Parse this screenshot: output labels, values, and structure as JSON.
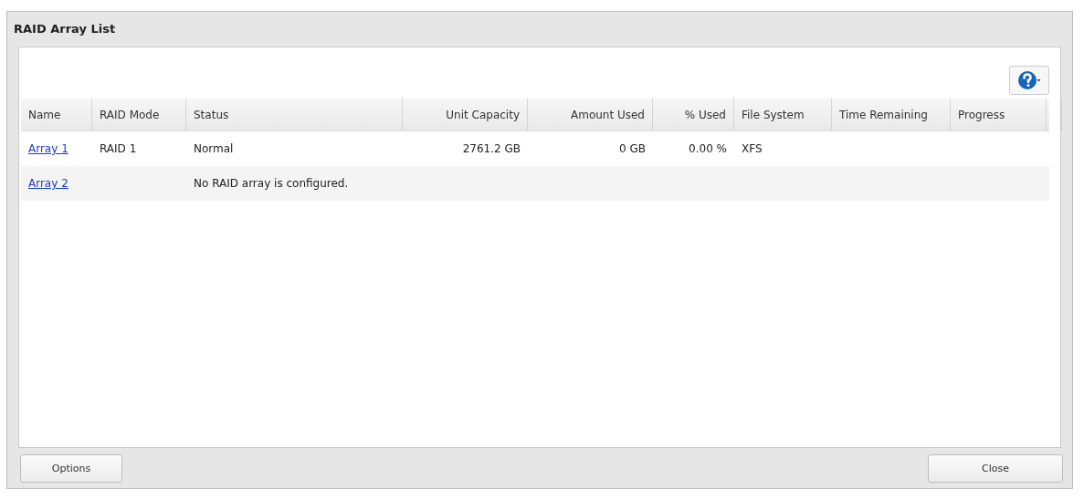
{
  "window": {
    "title": "RAID Array List"
  },
  "table": {
    "columns": [
      "Name",
      "RAID Mode",
      "Status",
      "Unit Capacity",
      "Amount Used",
      "% Used",
      "File System",
      "Time Remaining",
      "Progress"
    ],
    "rows": [
      [
        "Array 1",
        "RAID 1",
        "Normal",
        "2761.2 GB",
        "0 GB",
        "0.00 %",
        "XFS",
        "",
        ""
      ],
      [
        "Array 2",
        "",
        "No RAID array is configured.",
        "",
        "",
        "",
        "",
        "",
        ""
      ]
    ]
  },
  "buttons": {
    "left": "Options",
    "right": "Close"
  }
}
